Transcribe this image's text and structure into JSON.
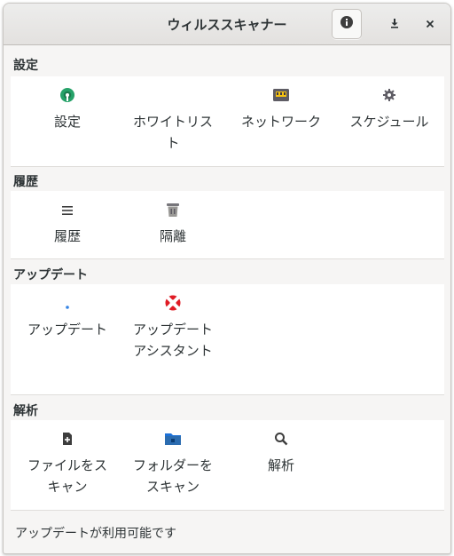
{
  "window": {
    "title": "ウィルススキャナー"
  },
  "headerbar": {
    "buttons": [
      {
        "icon": "info-icon"
      },
      {
        "icon": "download-icon"
      },
      {
        "icon": "close-icon"
      }
    ]
  },
  "sections": {
    "settings": {
      "title": "設定",
      "items": [
        {
          "label": "設定",
          "icon": "settings-app-icon"
        },
        {
          "label": "ホワイトリス\nト",
          "icon": "whitelist-icon"
        },
        {
          "label": "ネットワーク",
          "icon": "network-icon"
        },
        {
          "label": "スケジュール",
          "icon": "schedule-gear-icon"
        }
      ]
    },
    "history": {
      "title": "履歴",
      "items": [
        {
          "label": "履歴",
          "icon": "list-icon"
        },
        {
          "label": "隔離",
          "icon": "trash-icon"
        }
      ]
    },
    "update": {
      "title": "アップデート",
      "items": [
        {
          "label": "アップデート",
          "icon": "update-dot-icon"
        },
        {
          "label": "アップデート\nアシスタント",
          "icon": "lifebuoy-icon"
        }
      ]
    },
    "analysis": {
      "title": "解析",
      "items": [
        {
          "label": "ファイルをス\nキャン",
          "icon": "file-add-icon"
        },
        {
          "label": "フォルダーを\nスキャン",
          "icon": "folder-icon"
        },
        {
          "label": "解析",
          "icon": "search-icon"
        }
      ]
    }
  },
  "status": {
    "text": "アップデートが利用可能です"
  },
  "colors": {
    "accent_blue": "#3584e4",
    "settings_green": "#26a269",
    "lifebuoy_red": "#e01b24",
    "folder_blue": "#2b6cb0"
  }
}
